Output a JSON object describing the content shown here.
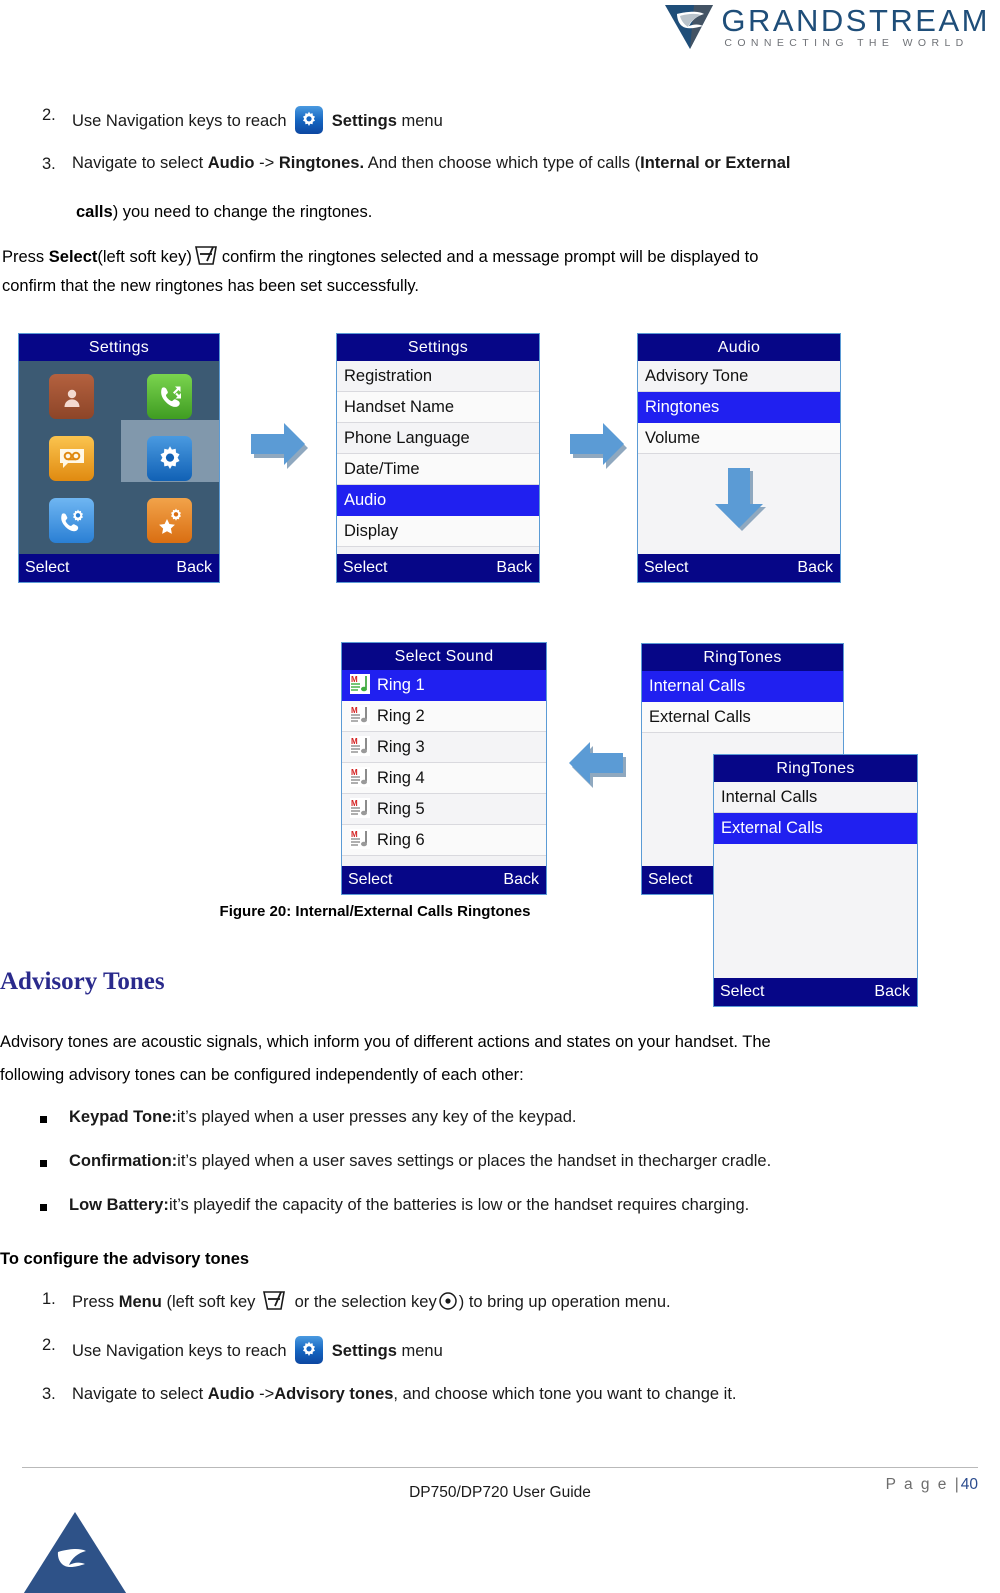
{
  "header": {
    "brand": "GRANDSTREAM",
    "tagline": "CONNECTING THE WORLD",
    "logo_icon": "grandstream-swoosh-icon",
    "brand_color": "#1F4E79"
  },
  "steps_top": [
    {
      "index": "2.",
      "pre": "Use Navigation keys to reach",
      "icon": "gear-icon",
      "bold": "Settings",
      "post": "menu"
    },
    {
      "index": "3.",
      "line1_pre": "Navigate to select ",
      "line1_b1": "Audio",
      "line1_mid": " -> ",
      "line1_b2": "Ringtones.",
      "line1_post": " And then choose which type of calls (",
      "line1_b3": "Internal or External",
      "line2_b": "calls",
      "line2_post": ") you need to change the ringtones."
    }
  ],
  "press_select": {
    "pre": "Press ",
    "bold": "Select",
    "mid": "(left soft key)",
    "icon": "soft-key-icon",
    "post": "confirm the ringtones selected and a message prompt will be  displayed to",
    "line2": "confirm that the new ringtones has been set successfully."
  },
  "screens": {
    "settings_grid": {
      "title": "Settings",
      "soft_left": "Select",
      "soft_right": "Back",
      "icons": [
        {
          "name": "contacts-icon",
          "color": "#9a4e34"
        },
        {
          "name": "call-history-icon",
          "color": "#4caf29"
        },
        {
          "name": "voicemail-icon",
          "color": "#f0a220"
        },
        {
          "name": "settings-gear-icon",
          "color": "#1b72c9",
          "selected": true
        },
        {
          "name": "call-settings-icon",
          "color": "#3d93e8"
        },
        {
          "name": "shortcut-star-icon",
          "color": "#e8861e"
        }
      ]
    },
    "settings_list": {
      "title": "Settings",
      "items": [
        "Registration",
        "Handset Name",
        "Phone Language",
        "Date/Time",
        "Audio",
        "Display"
      ],
      "selected": "Audio",
      "soft_left": "Select",
      "soft_right": "Back"
    },
    "audio": {
      "title": "Audio",
      "items": [
        "Advisory Tone",
        "Ringtones",
        "Volume"
      ],
      "selected": "Ringtones",
      "down_arrow_icon": "down-arrow-icon",
      "soft_left": "Select",
      "soft_right": "Back"
    },
    "select_sound": {
      "title": "Select Sound",
      "items": [
        "Ring 1",
        "Ring 2",
        "Ring 3",
        "Ring 4",
        "Ring 5",
        "Ring 6"
      ],
      "selected": "Ring 1",
      "row_icon": "music-note-icon",
      "soft_left": "Select",
      "soft_right": "Back"
    },
    "ringtones_back": {
      "title": "RingTones",
      "items": [
        "Internal Calls",
        "External Calls"
      ],
      "selected": "Internal Calls",
      "soft_left": "Select"
    },
    "ringtones_front": {
      "title": "RingTones",
      "items": [
        "Internal Calls",
        "External Calls"
      ],
      "selected": "External Calls",
      "soft_left": "Select",
      "soft_right": "Back"
    }
  },
  "arrows": {
    "right1_icon": "right-arrow-icon",
    "right2_icon": "right-arrow-icon",
    "left1_icon": "left-arrow-icon",
    "color": "#5B9BD5"
  },
  "caption": "Figure 20: Internal/External Calls Ringtones",
  "advisory": {
    "heading": "Advisory Tones",
    "heading_color": "#2a2a8c",
    "para_line1": "Advisory tones are acoustic signals, which inform you of different actions and states on your handset. The",
    "para_line2": "following advisory tones can be configured independently of each other:",
    "bullets": [
      {
        "bold": "Keypad Tone:",
        "text": "it’s played when a user presses any key of the keypad."
      },
      {
        "bold": "Confirmation:",
        "text": "it’s played when a user saves settings or places the handset in thecharger cradle."
      },
      {
        "bold": "Low Battery:",
        "text": "it’s playedif the capacity of the batteries is low or the handset requires charging."
      }
    ],
    "subheading": "To configure the advisory tones",
    "steps": [
      {
        "index": "1.",
        "pre": "Press ",
        "bold": "Menu",
        "mid": " (left soft key ",
        "softkey_icon": "soft-key-icon",
        "mid2": " or the selection key",
        "selkey_icon": "selection-key-icon",
        "post": ") to bring up operation menu."
      },
      {
        "index": "2.",
        "pre": "Use Navigation keys to reach",
        "icon": "gear-icon",
        "bold": "Settings",
        "post": "menu"
      },
      {
        "index": "3.",
        "pre": "Navigate to select ",
        "bold1": "Audio",
        "mid": " ->",
        "bold2": "Advisory tones",
        "post": ", and choose which tone you want to change it."
      }
    ]
  },
  "footer": {
    "center": "DP750/DP720 User Guide",
    "page_label": "P a g e |",
    "page_number": "40",
    "logo_icon": "grandstream-triangle-icon"
  }
}
